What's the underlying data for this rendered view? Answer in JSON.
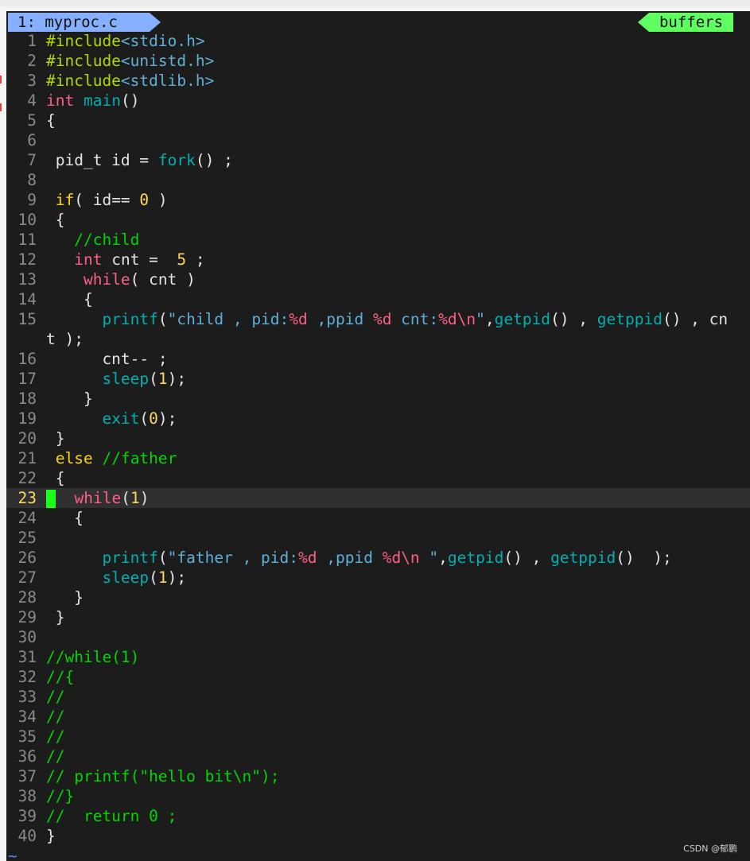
{
  "tab": {
    "active_label": "1: myproc.c",
    "right_label": "buffers"
  },
  "colors": {
    "tab_active": "#87afff",
    "buffers": "#5fff5f",
    "cursor": "#1aff1a",
    "background": "#1c1c1c"
  },
  "cursor_line": 23,
  "lines": [
    {
      "n": "1",
      "segs": [
        [
          "pre",
          "#include"
        ],
        [
          "inc",
          "<stdio.h>"
        ]
      ]
    },
    {
      "n": "2",
      "segs": [
        [
          "pre",
          "#include"
        ],
        [
          "inc",
          "<unistd.h>"
        ]
      ]
    },
    {
      "n": "3",
      "segs": [
        [
          "pre",
          "#include"
        ],
        [
          "inc",
          "<stdlib.h>"
        ]
      ]
    },
    {
      "n": "4",
      "segs": [
        [
          "type",
          "int"
        ],
        [
          "plain",
          " "
        ],
        [
          "fn",
          "main"
        ],
        [
          "plain",
          "()"
        ]
      ]
    },
    {
      "n": "5",
      "segs": [
        [
          "plain",
          "{"
        ]
      ]
    },
    {
      "n": "6",
      "segs": []
    },
    {
      "n": "7",
      "segs": [
        [
          "plain",
          " pid_t id = "
        ],
        [
          "fn",
          "fork"
        ],
        [
          "plain",
          "() ;"
        ]
      ]
    },
    {
      "n": "8",
      "segs": []
    },
    {
      "n": "9",
      "segs": [
        [
          "plain",
          " "
        ],
        [
          "kw",
          "if"
        ],
        [
          "plain",
          "( id== "
        ],
        [
          "num",
          "0"
        ],
        [
          "plain",
          " )"
        ]
      ]
    },
    {
      "n": "10",
      "segs": [
        [
          "plain",
          " {"
        ]
      ]
    },
    {
      "n": "11",
      "segs": [
        [
          "plain",
          "   "
        ],
        [
          "cmt",
          "//child"
        ]
      ]
    },
    {
      "n": "12",
      "segs": [
        [
          "plain",
          "   "
        ],
        [
          "type",
          "int"
        ],
        [
          "plain",
          " cnt =  "
        ],
        [
          "num",
          "5"
        ],
        [
          "plain",
          " ;"
        ]
      ]
    },
    {
      "n": "13",
      "segs": [
        [
          "plain",
          "    "
        ],
        [
          "type",
          "while"
        ],
        [
          "plain",
          "( cnt )"
        ]
      ]
    },
    {
      "n": "14",
      "segs": [
        [
          "plain",
          "    {"
        ]
      ]
    },
    {
      "n": "15",
      "segs": [
        [
          "plain",
          "      "
        ],
        [
          "fn",
          "printf"
        ],
        [
          "plain",
          "("
        ],
        [
          "str",
          "\"child , pid:"
        ],
        [
          "fmt",
          "%d"
        ],
        [
          "str",
          " ,ppid "
        ],
        [
          "fmt",
          "%d"
        ],
        [
          "str",
          " cnt:"
        ],
        [
          "fmt",
          "%d\\n"
        ],
        [
          "str",
          "\""
        ],
        [
          "plain",
          ","
        ],
        [
          "fn",
          "getpid"
        ],
        [
          "plain",
          "() , "
        ],
        [
          "fn",
          "getppid"
        ],
        [
          "plain",
          "() , cn"
        ]
      ]
    },
    {
      "n": "",
      "wrap": true,
      "segs": [
        [
          "plain",
          "t );"
        ]
      ]
    },
    {
      "n": "16",
      "segs": [
        [
          "plain",
          "      cnt-- ;"
        ]
      ]
    },
    {
      "n": "17",
      "segs": [
        [
          "plain",
          "      "
        ],
        [
          "fn",
          "sleep"
        ],
        [
          "plain",
          "("
        ],
        [
          "num",
          "1"
        ],
        [
          "plain",
          ");"
        ]
      ]
    },
    {
      "n": "18",
      "segs": [
        [
          "plain",
          "    }"
        ]
      ]
    },
    {
      "n": "19",
      "segs": [
        [
          "plain",
          "      "
        ],
        [
          "fn",
          "exit"
        ],
        [
          "plain",
          "("
        ],
        [
          "num",
          "0"
        ],
        [
          "plain",
          ");"
        ]
      ]
    },
    {
      "n": "20",
      "segs": [
        [
          "plain",
          " }"
        ]
      ]
    },
    {
      "n": "21",
      "segs": [
        [
          "plain",
          " "
        ],
        [
          "kw",
          "else"
        ],
        [
          "plain",
          " "
        ],
        [
          "cmt",
          "//father"
        ]
      ]
    },
    {
      "n": "22",
      "segs": [
        [
          "plain",
          " {"
        ]
      ]
    },
    {
      "n": "23",
      "cursor": true,
      "segs": [
        [
          "plain",
          "  "
        ],
        [
          "type",
          "while"
        ],
        [
          "plain",
          "("
        ],
        [
          "num",
          "1"
        ],
        [
          "plain",
          ")"
        ]
      ]
    },
    {
      "n": "24",
      "segs": [
        [
          "plain",
          "   {"
        ]
      ]
    },
    {
      "n": "25",
      "segs": []
    },
    {
      "n": "26",
      "segs": [
        [
          "plain",
          "      "
        ],
        [
          "fn",
          "printf"
        ],
        [
          "plain",
          "("
        ],
        [
          "str",
          "\"father , pid:"
        ],
        [
          "fmt",
          "%d"
        ],
        [
          "str",
          " ,ppid "
        ],
        [
          "fmt",
          "%d\\n"
        ],
        [
          "str",
          " \""
        ],
        [
          "plain",
          ","
        ],
        [
          "fn",
          "getpid"
        ],
        [
          "plain",
          "() , "
        ],
        [
          "fn",
          "getppid"
        ],
        [
          "plain",
          "()  );"
        ]
      ]
    },
    {
      "n": "27",
      "segs": [
        [
          "plain",
          "      "
        ],
        [
          "fn",
          "sleep"
        ],
        [
          "plain",
          "("
        ],
        [
          "num",
          "1"
        ],
        [
          "plain",
          ");"
        ]
      ]
    },
    {
      "n": "28",
      "segs": [
        [
          "plain",
          "   }"
        ]
      ]
    },
    {
      "n": "29",
      "segs": [
        [
          "plain",
          " }"
        ]
      ]
    },
    {
      "n": "30",
      "segs": []
    },
    {
      "n": "31",
      "segs": [
        [
          "cmt",
          "//while(1)"
        ]
      ]
    },
    {
      "n": "32",
      "segs": [
        [
          "cmt",
          "//{"
        ]
      ]
    },
    {
      "n": "33",
      "segs": [
        [
          "cmt",
          "//"
        ]
      ]
    },
    {
      "n": "34",
      "segs": [
        [
          "cmt",
          "//"
        ]
      ]
    },
    {
      "n": "35",
      "segs": [
        [
          "cmt",
          "//"
        ]
      ]
    },
    {
      "n": "36",
      "segs": [
        [
          "cmt",
          "//"
        ]
      ]
    },
    {
      "n": "37",
      "segs": [
        [
          "cmt",
          "// printf(\"hello bit\\n\");"
        ]
      ]
    },
    {
      "n": "38",
      "segs": [
        [
          "cmt",
          "//}"
        ]
      ]
    },
    {
      "n": "39",
      "segs": [
        [
          "cmt",
          "//  return 0 ;"
        ]
      ]
    },
    {
      "n": "40",
      "segs": [
        [
          "plain",
          "}"
        ]
      ]
    }
  ],
  "tilde": "~",
  "watermark": "CSDN @郁鹏"
}
